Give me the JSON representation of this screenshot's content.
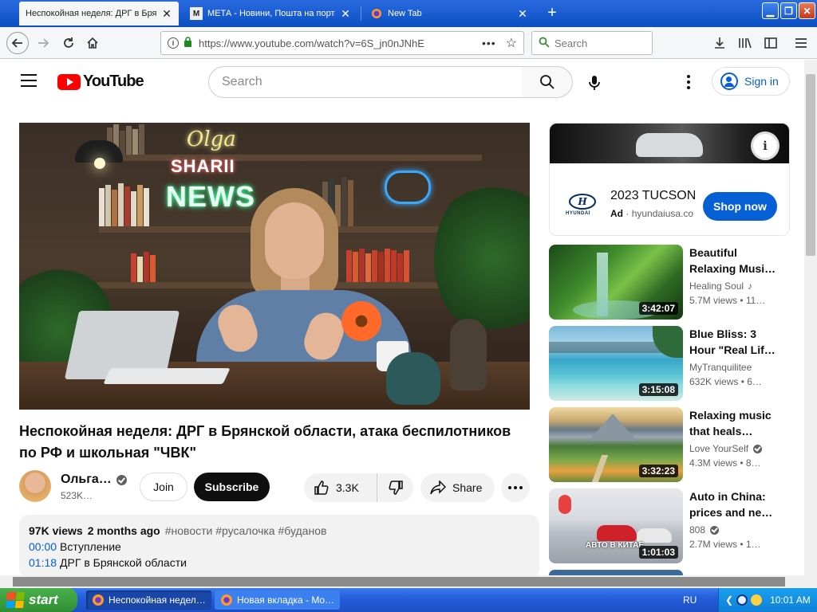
{
  "browser": {
    "tabs": [
      {
        "title": "Неспокойная неделя: ДРГ в Брянской",
        "active": true
      },
      {
        "title": "МЕТА - Новини, Пошта на порталі",
        "favicon": "M",
        "active": false
      },
      {
        "title": "New Tab",
        "active": false
      }
    ],
    "url": "https://www.youtube.com/watch?v=6S_jn0nJNhE",
    "search_placeholder": "Search",
    "new_tab_symbol": "+"
  },
  "youtube": {
    "logo_text": "YouTube",
    "search_placeholder": "Search",
    "signin_label": "Sign in"
  },
  "player": {
    "neon_name": "Olga",
    "neon_surname": "SHARII",
    "neon_news": "NEWS"
  },
  "video": {
    "title": "Неспокойная неделя: ДРГ в Брянской области, атака беспилотников по РФ и школьная \"ЧВК\"",
    "channel_name": "Ольга…",
    "subscribers": "523K…",
    "join_label": "Join",
    "subscribe_label": "Subscribe",
    "likes": "3.3K",
    "share_label": "Share",
    "views": "97K views",
    "posted": "2 months ago",
    "tags": "#новости #русалочка #буданов",
    "chapters": [
      {
        "time": "00:00",
        "label": "Вступление"
      },
      {
        "time": "01:18",
        "label": "ДРГ в Брянской области"
      }
    ]
  },
  "ad": {
    "title": "2023 TUCSON",
    "label": "Ad",
    "separator": "·",
    "domain": "hyundaiusa.com",
    "cta": "Shop now",
    "brand": "HYUNDAI",
    "brand_mark": "H",
    "info_symbol": "i"
  },
  "recommendations": [
    {
      "title": "Beautiful Relaxing Musi…",
      "channel": "Healing Soul",
      "channel_badge": "music",
      "meta": "5.7M views • 11…",
      "duration": "3:42:07"
    },
    {
      "title": "Blue Bliss: 3 Hour \"Real Lif…",
      "channel": "MyTranquilitee",
      "channel_badge": "none",
      "meta": "632K views • 6…",
      "duration": "3:15:08"
    },
    {
      "title": "Relaxing music that heals…",
      "channel": "Love YourSelf",
      "channel_badge": "verified",
      "meta": "4.3M views • 8…",
      "duration": "3:32:23"
    },
    {
      "title": "Auto in China: prices and ne…",
      "channel": "808",
      "channel_badge": "verified",
      "meta": "2.7M views • 1…",
      "duration": "1:01:03",
      "overlay_text": "АВТО В КИТАЕ"
    }
  ],
  "taskbar": {
    "start_label": "start",
    "tasks": [
      {
        "label": "Неспокойная недел…"
      },
      {
        "label": "Новая вкладка - Mo…"
      }
    ],
    "language": "RU",
    "clock": "10:01 AM"
  },
  "colors": {
    "youtube_red": "#ff0000",
    "link_blue": "#065fd4",
    "xp_taskbar": "#245edb",
    "xp_start": "#3c9f3f"
  }
}
